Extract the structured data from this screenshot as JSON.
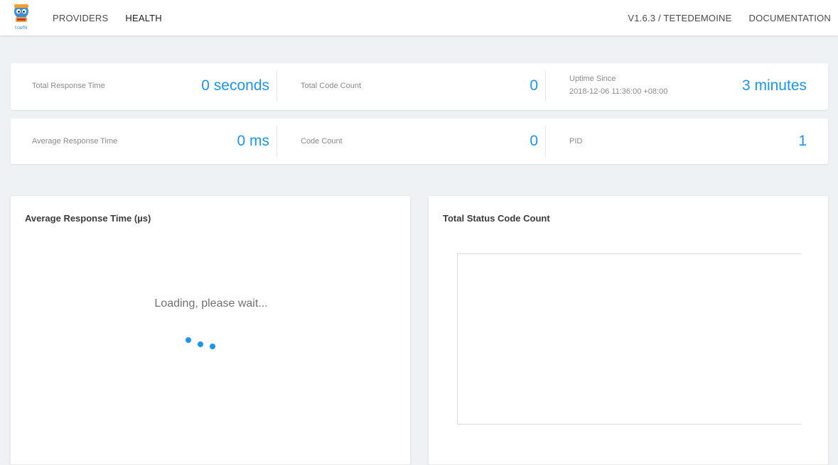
{
  "navbar": {
    "logo_text": "træfik",
    "left_links": [
      {
        "label": "PROVIDERS",
        "active": false
      },
      {
        "label": "HEALTH",
        "active": true
      }
    ],
    "version": "V1.6.3 / TETEDEMOINE",
    "documentation": "DOCUMENTATION"
  },
  "stats": {
    "total_response_time": {
      "label": "Total Response Time",
      "value": "0 seconds"
    },
    "total_code_count": {
      "label": "Total Code Count",
      "value": "0"
    },
    "uptime": {
      "label": "Uptime Since",
      "since": "2018-12-06 11:36:00 +08:00",
      "value": "3 minutes"
    },
    "average_response_time": {
      "label": "Average Response Time",
      "value": "0 ms"
    },
    "code_count": {
      "label": "Code Count",
      "value": "0"
    },
    "pid": {
      "label": "PID",
      "value": "1"
    }
  },
  "panels": {
    "avg_response": {
      "title": "Average Response Time (µs)",
      "loading": "Loading, please wait..."
    },
    "status_count": {
      "title": "Total Status Code Count"
    }
  },
  "colors": {
    "accent": "#1b94f2",
    "background": "#eff2f5",
    "card": "#ffffff"
  }
}
